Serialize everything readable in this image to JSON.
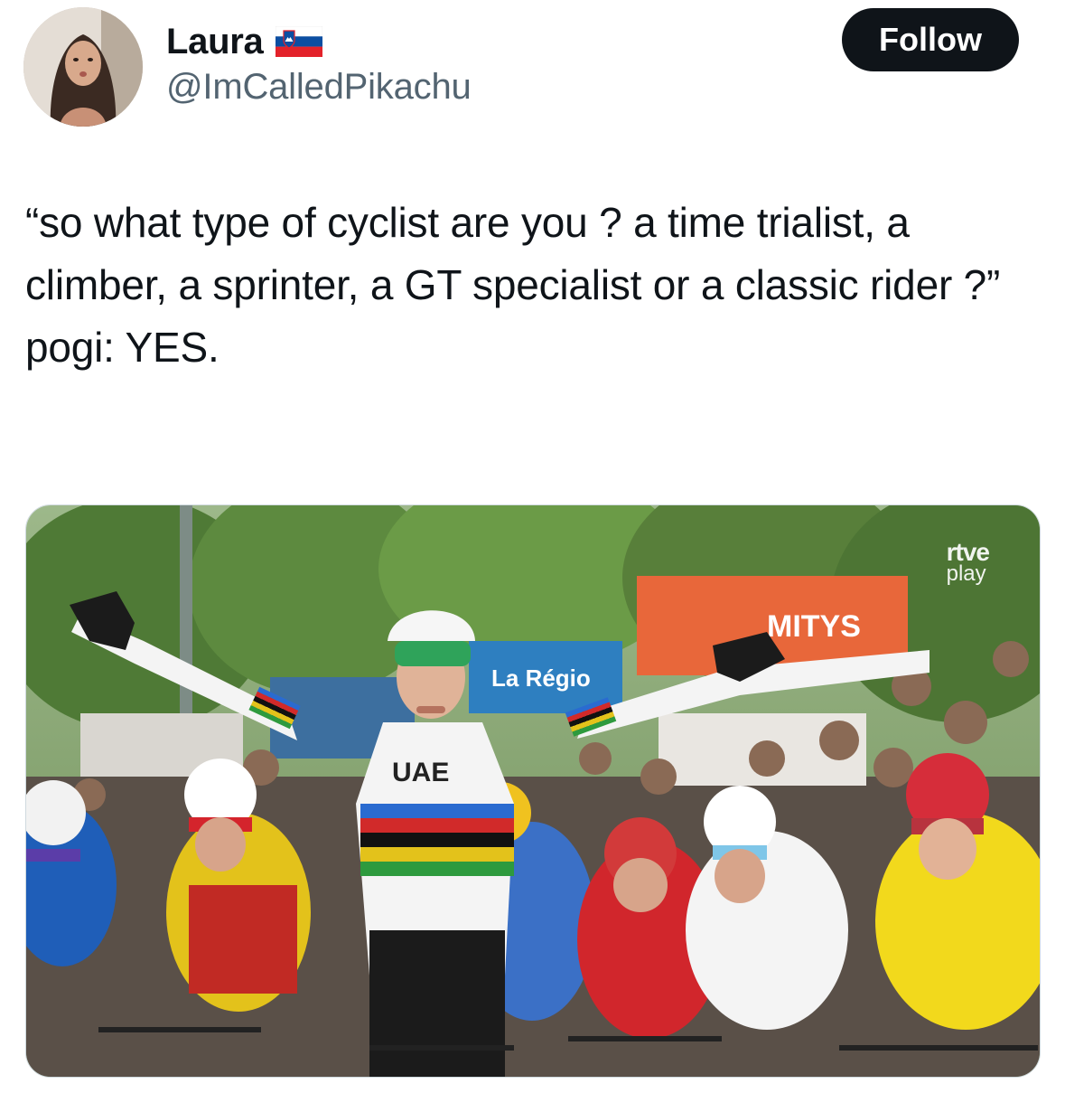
{
  "author": {
    "display_name": "Laura",
    "handle": "@ImCalledPikachu",
    "flag_icon": "slovenia-flag-icon"
  },
  "follow_button": {
    "label": "Follow"
  },
  "tweet": {
    "paragraph_1": "“so what type of cyclist are you ? a time trialist, a climber, a sprinter, a GT specialist or a classic rider ?”",
    "paragraph_2": "pogi: YES."
  },
  "media": {
    "watermark_brand": "rtve",
    "watermark_sub": "play",
    "jersey_text": "UAE",
    "banner_left": "La Régio",
    "banner_right": "MITYS"
  },
  "colors": {
    "text_primary": "#0f1419",
    "text_secondary": "#536471",
    "follow_bg": "#0f1419",
    "follow_text": "#ffffff"
  }
}
